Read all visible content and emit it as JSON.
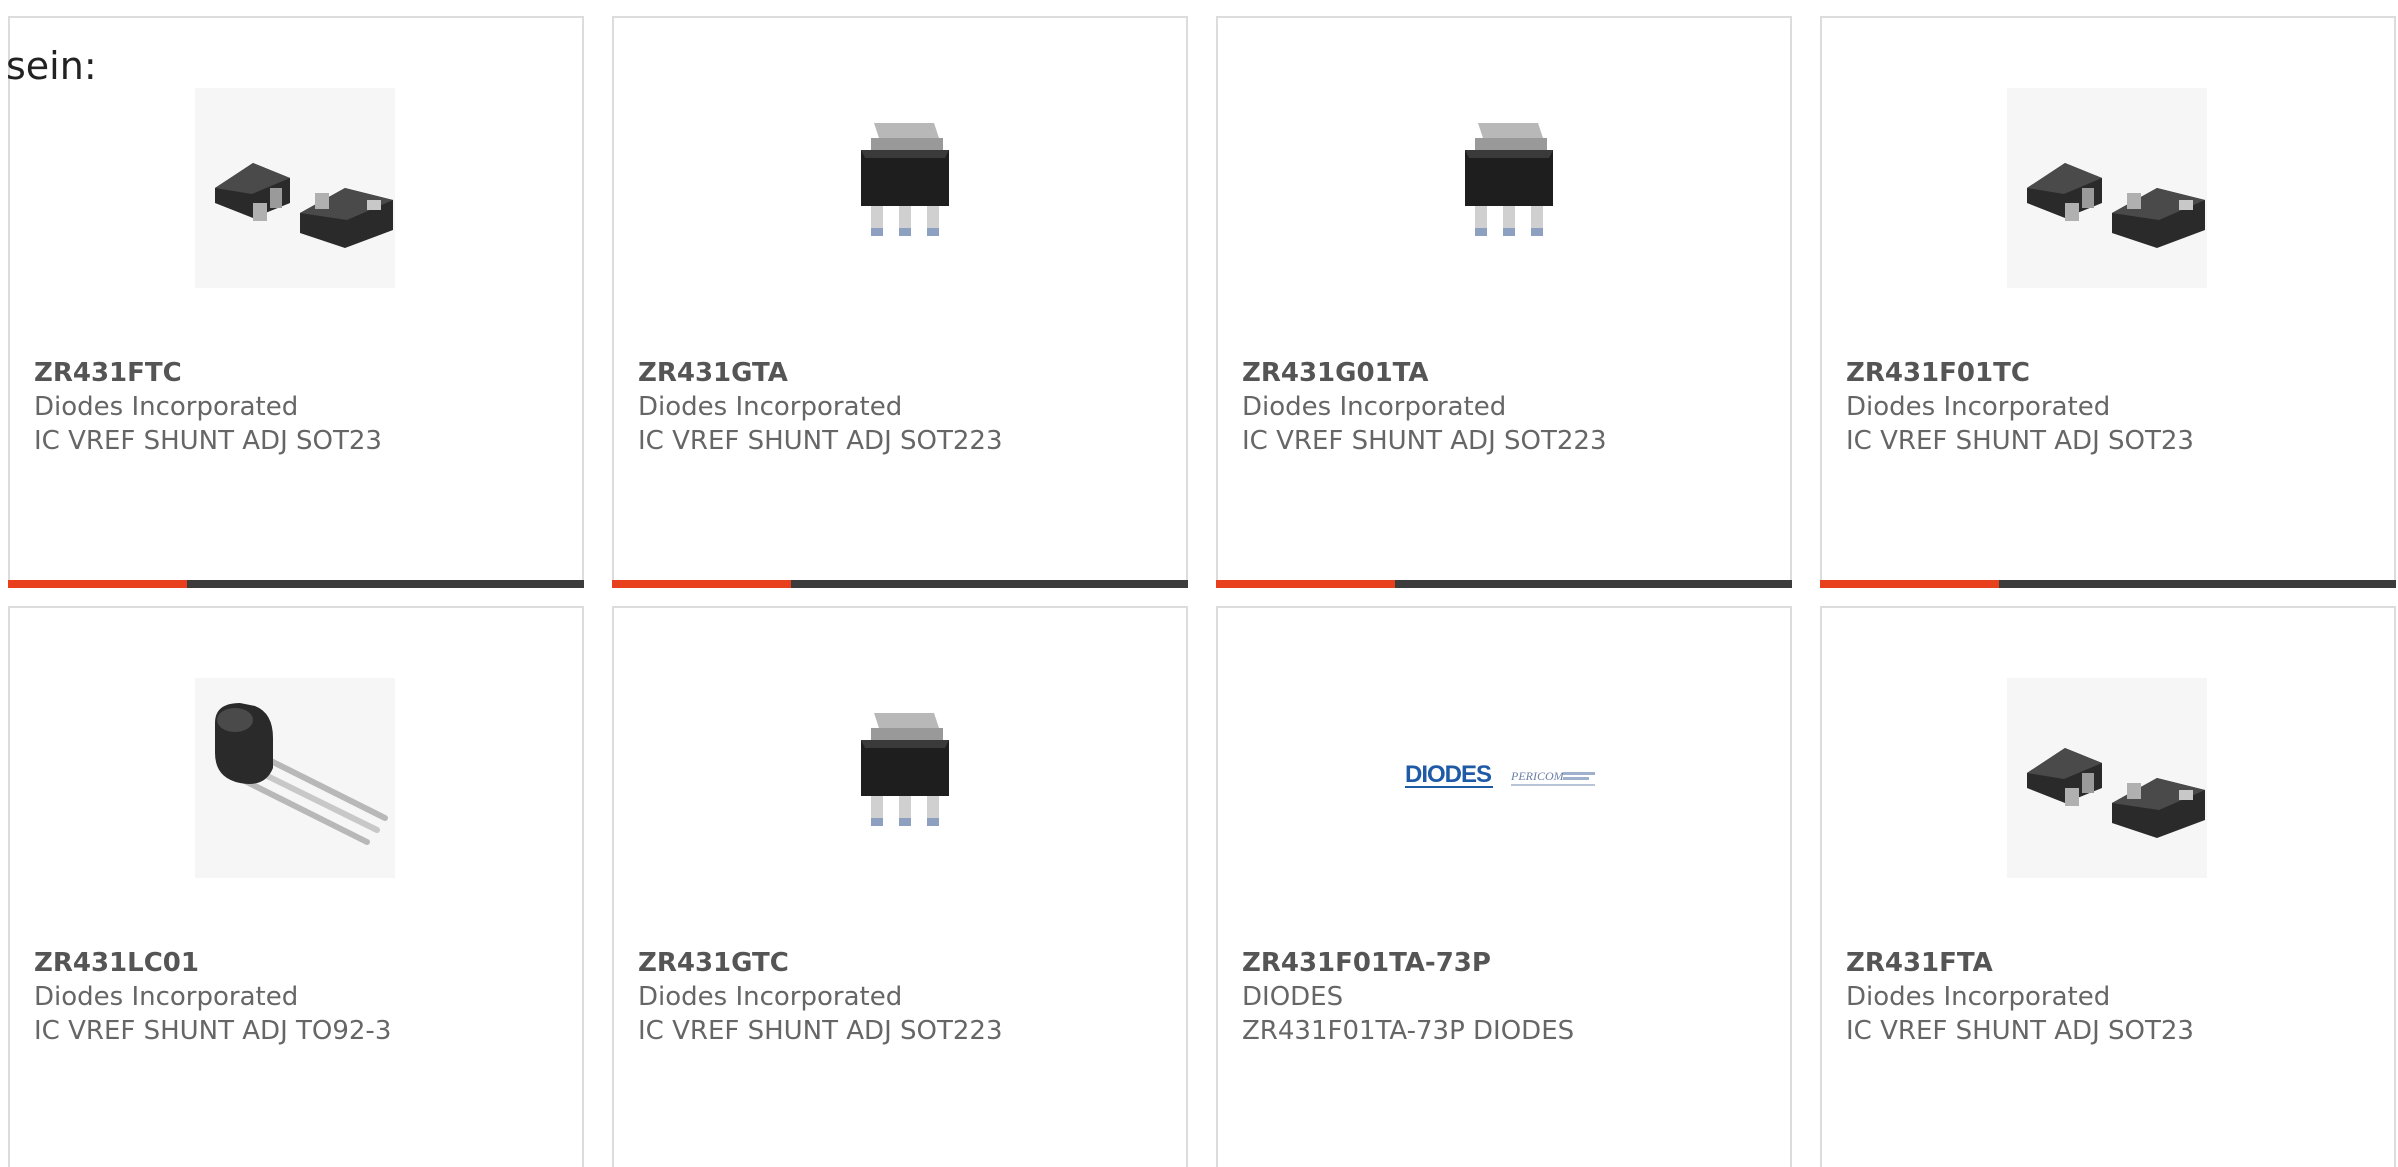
{
  "intro_text": "sein:",
  "colors": {
    "accent": "#e8401c",
    "bar_dark": "#3c3c3c",
    "card_border": "#dcdcdc",
    "text": "#666666",
    "diodes_blue": "#1f5aa6"
  },
  "products": [
    {
      "part_number": "ZR431FTC",
      "manufacturer": "Diodes Incorporated",
      "description": "IC VREF SHUNT ADJ SOT23",
      "image": "sot23-package-image",
      "progress": 0.31
    },
    {
      "part_number": "ZR431GTA",
      "manufacturer": "Diodes Incorporated",
      "description": "IC VREF SHUNT ADJ SOT223",
      "image": "sot223-package-image",
      "progress": 0.31
    },
    {
      "part_number": "ZR431G01TA",
      "manufacturer": "Diodes Incorporated",
      "description": "IC VREF SHUNT ADJ SOT223",
      "image": "sot223-package-image",
      "progress": 0.31
    },
    {
      "part_number": "ZR431F01TC",
      "manufacturer": "Diodes Incorporated",
      "description": "IC VREF SHUNT ADJ SOT23",
      "image": "sot23-package-image",
      "progress": 0.31
    },
    {
      "part_number": "ZR431LC01",
      "manufacturer": "Diodes Incorporated",
      "description": "IC VREF SHUNT ADJ TO92-3",
      "image": "to92-package-image",
      "progress": null
    },
    {
      "part_number": "ZR431GTC",
      "manufacturer": "Diodes Incorporated",
      "description": "IC VREF SHUNT ADJ SOT223",
      "image": "sot223-package-image",
      "progress": null
    },
    {
      "part_number": "ZR431F01TA-73P",
      "manufacturer": "DIODES",
      "description": "ZR431F01TA-73P DIODES",
      "image": "diodes-pericom-logo",
      "logo_text": "DIODES",
      "logo_sub_text": "PERICOM",
      "progress": null
    },
    {
      "part_number": "ZR431FTA",
      "manufacturer": "Diodes Incorporated",
      "description": "IC VREF SHUNT ADJ SOT23",
      "image": "sot23-package-image",
      "progress": null
    }
  ]
}
